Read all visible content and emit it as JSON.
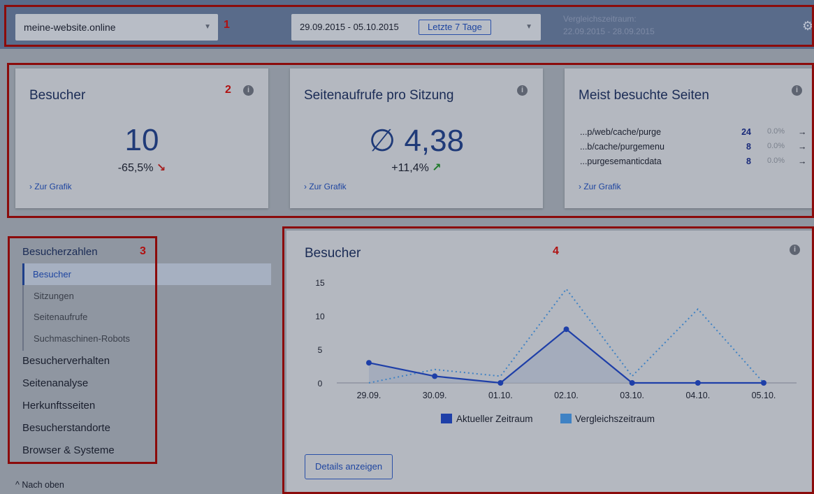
{
  "topbar": {
    "site": "meine-website.online",
    "date_range": "29.09.2015 - 05.10.2015",
    "range_button": "Letzte 7 Tage",
    "compare_label": "Vergleichszeitraum:",
    "compare_range": "22.09.2015 - 28.09.2015"
  },
  "callouts": [
    "1",
    "2",
    "3",
    "4"
  ],
  "cards": [
    {
      "title": "Besucher",
      "value": "10",
      "delta": "-65,5%",
      "trend": "↘",
      "link": "› Zur Grafik"
    },
    {
      "title": "Seitenaufrufe pro Sitzung",
      "value": "∅ 4,38",
      "delta": "+11,4%",
      "trend": "↗",
      "link": "› Zur Grafik"
    },
    {
      "title": "Meist besuchte Seiten",
      "link": "› Zur Grafik",
      "pages": [
        {
          "path": "...p/web/cache/purge",
          "count": "24",
          "pct": "0.0%"
        },
        {
          "path": "...b/cache/purgemenu",
          "count": "8",
          "pct": "0.0%"
        },
        {
          "path": "...purgesemanticdata",
          "count": "8",
          "pct": "0.0%"
        }
      ]
    }
  ],
  "sidebar": {
    "heading": "Besucherzahlen",
    "sub_items": [
      "Besucher",
      "Sitzungen",
      "Seitenaufrufe",
      "Suchmaschinen-Robots"
    ],
    "items": [
      "Besucherverhalten",
      "Seitenanalyse",
      "Herkunftsseiten",
      "Besucherstandorte",
      "Browser & Systeme"
    ],
    "to_top": "Nach oben"
  },
  "panel": {
    "title": "Besucher",
    "details_button": "Details anzeigen"
  },
  "chart_data": {
    "type": "line",
    "title": "Besucher",
    "x": [
      "29.09.",
      "30.09.",
      "01.10.",
      "02.10.",
      "03.10.",
      "04.10.",
      "05.10."
    ],
    "yticks": [
      0,
      5,
      10,
      15
    ],
    "ylim": [
      0,
      15
    ],
    "series": [
      {
        "name": "Aktueller Zeitraum",
        "values": [
          3,
          1,
          0,
          8,
          0,
          0,
          0
        ],
        "color": "#1e3fa8",
        "style": "solid"
      },
      {
        "name": "Vergleichszeitraum",
        "values": [
          0,
          2,
          1,
          14,
          1,
          11,
          0
        ],
        "color": "#3f82c4",
        "style": "dotted"
      }
    ],
    "legend": "bottom"
  }
}
